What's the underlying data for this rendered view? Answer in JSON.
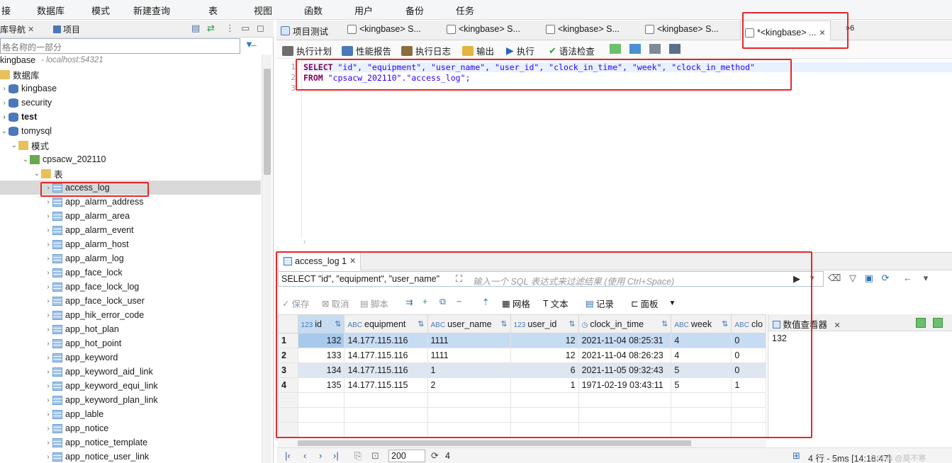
{
  "menu": [
    "接",
    "数据库",
    "模式",
    "新建查询",
    "表",
    "视图",
    "函数",
    "用户",
    "备份",
    "任务"
  ],
  "left_panel": {
    "tab_navigator": "库导航",
    "tab_project": "项目",
    "filter_placeholder": "格名称的一部分",
    "tree": {
      "connection": "kingbase",
      "connection_meta": "- localhost:54321",
      "databases_folder": "数据库",
      "databases": [
        "kingbase",
        "security",
        "test",
        "tomysql"
      ],
      "schemas_folder": "模式",
      "schema": "cpsacw_202110",
      "tables_folder": "表",
      "tables": [
        "access_log",
        "app_alarm_address",
        "app_alarm_area",
        "app_alarm_event",
        "app_alarm_host",
        "app_alarm_log",
        "app_face_lock",
        "app_face_lock_log",
        "app_face_lock_user",
        "app_hik_error_code",
        "app_hot_plan",
        "app_hot_point",
        "app_keyword",
        "app_keyword_aid_link",
        "app_keyword_equi_link",
        "app_keyword_plan_link",
        "app_lable",
        "app_notice",
        "app_notice_template",
        "app_notice_user_link"
      ]
    }
  },
  "editor_tabs": {
    "project": "项目测试",
    "others": [
      "<kingbase> S...",
      "<kingbase> S...",
      "<kingbase> S...",
      "<kingbase> S..."
    ],
    "active": "*<kingbase> ...",
    "overflow": "»6"
  },
  "editor_toolbar": {
    "plan": "执行计划",
    "perf": "性能报告",
    "log": "执行日志",
    "export": "输出",
    "run": "执行",
    "syntax": "语法检查"
  },
  "sql": {
    "line_numbers": [
      "1",
      "2",
      "3"
    ],
    "line1_kw": "SELECT",
    "line1_rest": " \"id\", \"equipment\", \"user_name\", \"user_id\", \"clock_in_time\", \"week\", \"clock_in_method\"",
    "line2_kw": "FROM",
    "line2_rest": " \"cpsacw_202110\".\"access_log\";"
  },
  "results": {
    "tab_label": "access_log 1",
    "filter_query": "SELECT \"id\", \"equipment\", \"user_name\"",
    "filter_placeholder": "输入一个 SQL 表达式来过滤结果 (使用 Ctrl+Space)",
    "toolbar": {
      "save": "保存",
      "cancel": "取消",
      "script": "脚本",
      "grid": "网格",
      "text": "文本",
      "record": "记录",
      "panel": "面板"
    },
    "columns": [
      {
        "type": "123",
        "name": "id"
      },
      {
        "type": "ABC",
        "name": "equipment"
      },
      {
        "type": "ABC",
        "name": "user_name"
      },
      {
        "type": "123",
        "name": "user_id"
      },
      {
        "type": "◷",
        "name": "clock_in_time"
      },
      {
        "type": "ABC",
        "name": "week"
      },
      {
        "type": "ABC",
        "name": "clo"
      }
    ],
    "rows": [
      {
        "n": "1",
        "id": "132",
        "equipment": "14.177.115.116",
        "user_name": "1111",
        "user_id": "12",
        "clock_in_time": "2021-11-04 08:25:31",
        "week": "4",
        "clock": "0"
      },
      {
        "n": "2",
        "id": "133",
        "equipment": "14.177.115.116",
        "user_name": "1111",
        "user_id": "12",
        "clock_in_time": "2021-11-04 08:26:23",
        "week": "4",
        "clock": "0"
      },
      {
        "n": "3",
        "id": "134",
        "equipment": "14.177.115.116",
        "user_name": "1",
        "user_id": "6",
        "clock_in_time": "2021-11-05 09:32:43",
        "week": "5",
        "clock": "0"
      },
      {
        "n": "4",
        "id": "135",
        "equipment": "14.177.115.115",
        "user_name": "2",
        "user_id": "1",
        "clock_in_time": "1971-02-19 03:43:11",
        "week": "5",
        "clock": "1"
      }
    ],
    "value_viewer": {
      "title": "数值查看器",
      "value": "132"
    },
    "pager": {
      "fetch_size": "200",
      "row_count": "4",
      "status": "4 行 - 5ms [14:18:47]",
      "watermark": "CSDN @莫不寒"
    }
  },
  "colors": {
    "highlight": "#e8262a",
    "selection": "#c6dcf3",
    "keyword": "#7f0055",
    "string": "#2a00ff"
  }
}
